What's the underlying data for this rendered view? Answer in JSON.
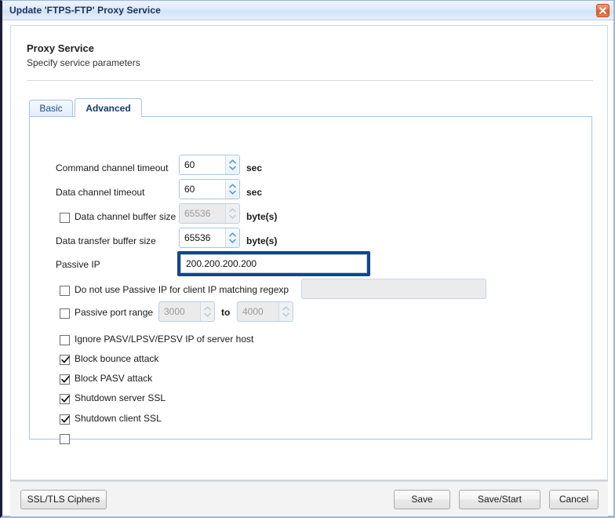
{
  "window": {
    "title": "Update 'FTPS-FTP' Proxy Service",
    "close_icon": "close-icon"
  },
  "page": {
    "heading": "Proxy Service",
    "subheading": "Specify service parameters"
  },
  "tabs": [
    {
      "label": "Basic",
      "active": false
    },
    {
      "label": "Advanced",
      "active": true
    }
  ],
  "form": {
    "command_channel_timeout": {
      "label": "Command channel timeout",
      "value": "60",
      "unit": "sec",
      "disabled": false
    },
    "data_channel_timeout": {
      "label": "Data channel timeout",
      "value": "60",
      "unit": "sec",
      "disabled": false
    },
    "data_channel_buffer_size": {
      "label": "Data channel buffer size",
      "value": "65536",
      "unit": "byte(s)",
      "checked": false,
      "disabled": true
    },
    "data_transfer_buffer_size": {
      "label": "Data transfer buffer size",
      "value": "65536",
      "unit": "byte(s)",
      "disabled": false
    },
    "passive_ip": {
      "label": "Passive IP",
      "value": "200.200.200.200",
      "focused": true
    },
    "no_passive_ip_regexp": {
      "label": "Do not use Passive IP for client IP matching regexp",
      "value": "",
      "checked": false,
      "disabled": true
    },
    "passive_port_range": {
      "label": "Passive port range",
      "from": "3000",
      "separator": "to",
      "to": "4000",
      "checked": false,
      "disabled": true
    },
    "checkboxes": [
      {
        "label": "Ignore PASV/LPSV/EPSV IP of server host",
        "checked": false
      },
      {
        "label": "Block bounce attack",
        "checked": true
      },
      {
        "label": "Block PASV attack",
        "checked": true
      },
      {
        "label": "Shutdown server SSL",
        "checked": true
      },
      {
        "label": "Shutdown client SSL",
        "checked": true
      }
    ]
  },
  "footer": {
    "ciphers_label": "SSL/TLS Ciphers",
    "save_label": "Save",
    "save_start_label": "Save/Start",
    "cancel_label": "Cancel"
  },
  "colors": {
    "titlebar_text": "#16335c",
    "focus_border": "#14448e",
    "tab_border": "#a6c3e4",
    "close_button": "#da5b28"
  }
}
